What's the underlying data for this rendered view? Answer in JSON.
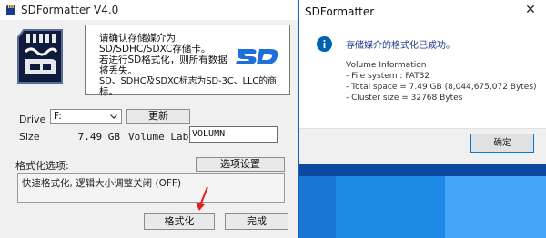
{
  "sdf": {
    "title": "SDFormatter V4.0",
    "info_lines": [
      "请确认存储媒介为",
      "SD/SDHC/SDXC存储卡。",
      "若进行SD格式化，则所有数据",
      "将丢失。",
      "SD、SDHC及SDXC标志为SD-3C、LLC的商",
      "标。"
    ],
    "drive_label": "Drive",
    "drive_value": "F:",
    "refresh_button": "更新",
    "size_label": "Size",
    "size_value": "7.49 GB",
    "volume_label": "Volume Label",
    "volume_value": "VOLUMN",
    "options_label": "格式化选项:",
    "options_button": "选项设置",
    "options_text": "快速格式化, 逻辑大小调整关闭 (OFF)",
    "format_button": "格式化",
    "finish_button": "完成"
  },
  "dialog": {
    "title": "SDFormatter",
    "close_glyph": "✕",
    "message": "存储媒介的格式化已成功。",
    "lines": [
      "Volume Information",
      "- File system : FAT32",
      "- Total space = 7.49 GB (8,044,675,072 Bytes)",
      "- Cluster size = 32768 Bytes"
    ],
    "ok_button": "确定"
  },
  "colors": {
    "accent": "#0078d7",
    "info_icon": "#0063b1",
    "arrow": "#e02020",
    "desktop": "#1976d2"
  },
  "icons": {
    "app": "sd-card-app-icon",
    "card": "sd-card-icon",
    "logo": "sd-logo-icon",
    "info": "info-icon",
    "arrow": "red-arrow-icon",
    "chevron": "chevron-down-icon"
  }
}
